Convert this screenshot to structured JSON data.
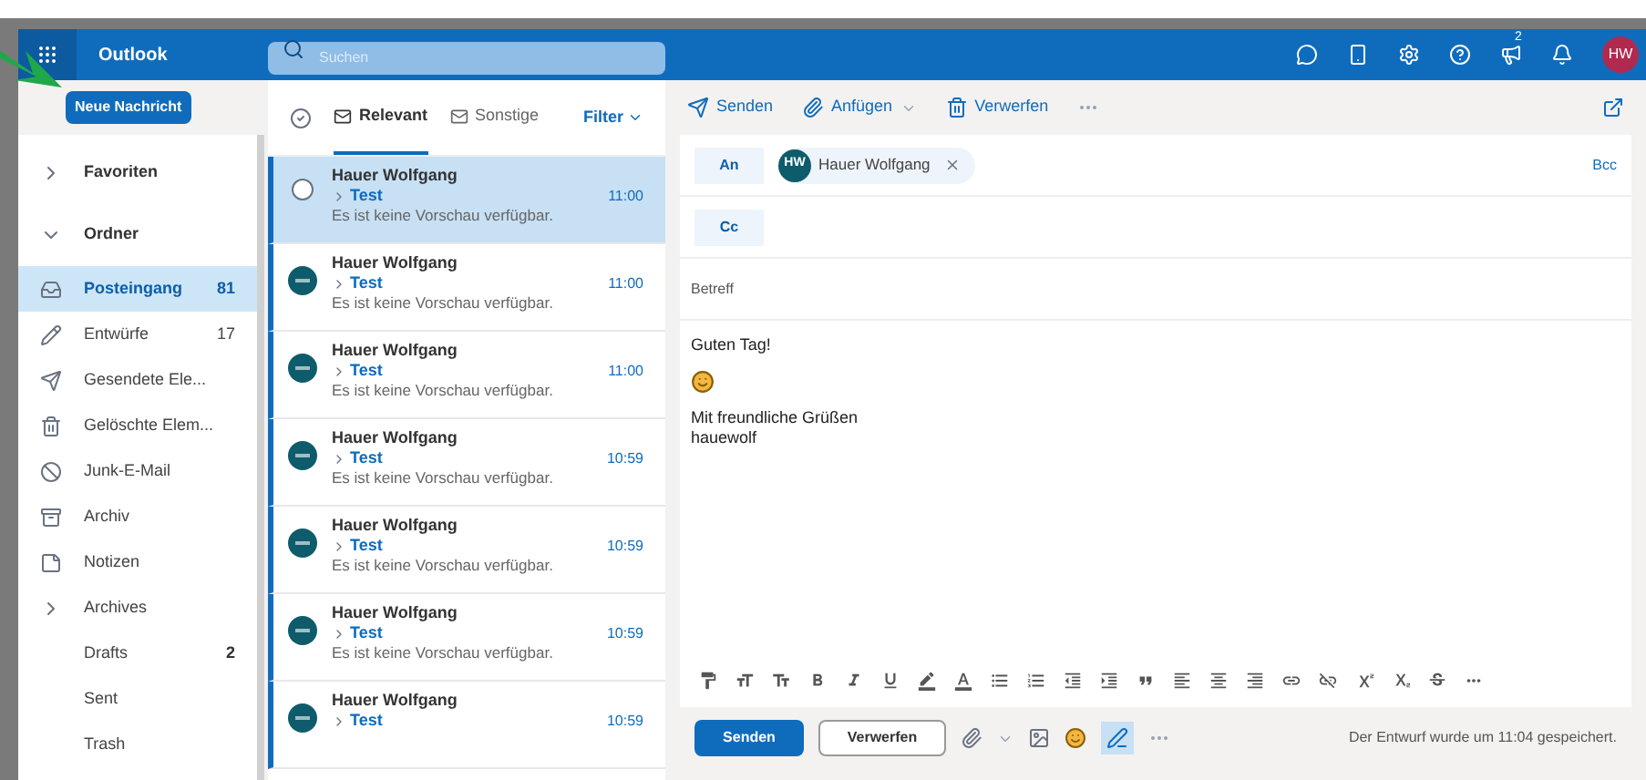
{
  "top_bar": {
    "app_name": "Outlook",
    "search": {
      "placeholder": "Suchen"
    },
    "notification_badge": "2",
    "avatar": "HW"
  },
  "new_message_button": "Neue Nachricht",
  "sidebar": {
    "favorites": {
      "label": "Favoriten",
      "expanded": false
    },
    "folders": {
      "label": "Ordner",
      "expanded": true
    },
    "items": [
      {
        "kind": "inbox",
        "label": "Posteingang",
        "count": "81",
        "selected": true
      },
      {
        "kind": "drafts",
        "label": "Entwürfe",
        "count": "17",
        "selected": false
      },
      {
        "kind": "sent",
        "label": "Gesendete Ele...",
        "selected": false
      },
      {
        "kind": "deleted",
        "label": "Gelöschte Elem...",
        "selected": false
      },
      {
        "kind": "junk",
        "label": "Junk-E-Mail",
        "selected": false
      },
      {
        "kind": "archive",
        "label": "Archiv",
        "selected": false
      },
      {
        "kind": "notes",
        "label": "Notizen",
        "selected": false
      },
      {
        "kind": "group",
        "label": "Archives",
        "selected": false,
        "expanded": false,
        "children": [
          {
            "label": "Drafts",
            "count": "2",
            "selected": false
          },
          {
            "label": "Sent",
            "selected": false
          },
          {
            "label": "Trash",
            "selected": false
          }
        ]
      }
    ]
  },
  "message_list": {
    "tabs": [
      {
        "label": "Relevant",
        "selected": true
      },
      {
        "label": "Sonstige",
        "selected": false
      }
    ],
    "filter": "Filter",
    "messages": [
      {
        "sender": "Hauer Wolfgang",
        "subject": "Test",
        "time": "11:00",
        "preview": "Es ist keine Vorschau verfügbar.",
        "selected": true
      },
      {
        "sender": "Hauer Wolfgang",
        "subject": "Test",
        "time": "11:00",
        "preview": "Es ist keine Vorschau verfügbar.",
        "selected": false
      },
      {
        "sender": "Hauer Wolfgang",
        "subject": "Test",
        "time": "11:00",
        "preview": "Es ist keine Vorschau verfügbar.",
        "selected": false
      },
      {
        "sender": "Hauer Wolfgang",
        "subject": "Test",
        "time": "10:59",
        "preview": "Es ist keine Vorschau verfügbar.",
        "selected": false
      },
      {
        "sender": "Hauer Wolfgang",
        "subject": "Test",
        "time": "10:59",
        "preview": "Es ist keine Vorschau verfügbar.",
        "selected": false
      },
      {
        "sender": "Hauer Wolfgang",
        "subject": "Test",
        "time": "10:59",
        "preview": "Es ist keine Vorschau verfügbar.",
        "selected": false
      },
      {
        "sender": "Hauer Wolfgang",
        "subject": "Test",
        "time": "10:59",
        "selected": false
      }
    ]
  },
  "compose": {
    "toolbar": [
      {
        "kind": "send",
        "label": "Senden"
      },
      {
        "kind": "attach",
        "label": "Anfügen"
      },
      {
        "kind": "discard",
        "label": "Verwerfen"
      }
    ],
    "to_label": "An",
    "recipient": {
      "initials": "HW",
      "name": "Hauer Wolfgang"
    },
    "bcc": "Bcc",
    "cc_label": "Cc",
    "subject_placeholder": "Betreff",
    "body": [
      {
        "kind": "text",
        "text": "Guten Tag!"
      },
      {
        "kind": "emoji"
      },
      {
        "kind": "text",
        "text": "Mit freundliche Grüßen"
      },
      {
        "kind": "text",
        "text": "hauewolf"
      }
    ],
    "send_button": "Senden",
    "discard_button": "Verwerfen",
    "immersive_toggle": {
      "on": true
    },
    "status": "Der Entwurf wurde um 11:04 gespeichert."
  }
}
